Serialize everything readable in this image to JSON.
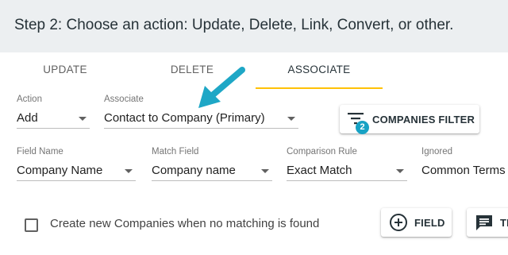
{
  "header": {
    "title": "Step 2: Choose an action: Update, Delete, Link, Convert, or other."
  },
  "tabs": [
    {
      "label": "UPDATE"
    },
    {
      "label": "DELETE"
    },
    {
      "label": "ASSOCIATE",
      "active": true
    }
  ],
  "row1": {
    "action": {
      "label": "Action",
      "value": "Add"
    },
    "associate": {
      "label": "Associate",
      "value": "Contact to Company (Primary)"
    },
    "filter_button": {
      "label": "COMPANIES FILTER",
      "badge": "2"
    }
  },
  "row2": {
    "field_name": {
      "label": "Field Name",
      "value": "Company Name"
    },
    "match_field": {
      "label": "Match Field",
      "value": "Company name"
    },
    "comparison_rule": {
      "label": "Comparison Rule",
      "value": "Exact Match"
    },
    "ignored": {
      "label": "Ignored",
      "value": "Common Terms"
    }
  },
  "bottom": {
    "checkbox_label": "Create new Companies when no matching is found",
    "field_button": "FIELD",
    "text_button": "TE"
  },
  "colors": {
    "accent": "#ffc107",
    "badge": "#17a2c4",
    "arrow": "#1ea7c6",
    "header_bg": "#eceff1"
  }
}
